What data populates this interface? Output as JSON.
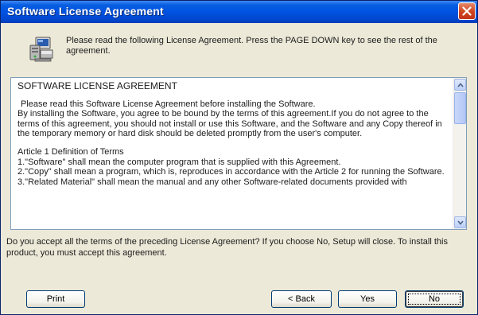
{
  "window": {
    "title": "Software License Agreement"
  },
  "header": {
    "instruction": "Please read the following License Agreement. Press the PAGE DOWN key to see the rest of the agreement.",
    "icon": "setup-computer-icon"
  },
  "license": {
    "heading": "SOFTWARE LICENSE AGREEMENT",
    "intro": "Please read this Software License Agreement before installing the Software.",
    "para1": "By installing the Software, you agree to be bound by the terms of this agreement.If you do not agree to the terms of this agreement, you should not install or use this Software, and the Software and any Copy thereof in the temporary memory or hard disk should be deleted promptly from the user's computer.",
    "article_title": "Article 1 Definition of Terms",
    "term1": "1.\"Software\" shall mean the computer program that is supplied with this Agreement.",
    "term2": "2.\"Copy\" shall mean a program, which is, reproduces in accordance with the Article 2 for running the Software.",
    "term3": "3.\"Related Material\"  shall mean the manual and any other Software-related documents provided with"
  },
  "question": "Do you accept all the terms of the preceding License Agreement? If you choose No, Setup will close. To install this product, you must accept this agreement.",
  "buttons": {
    "print": "Print",
    "back": "< Back",
    "yes": "Yes",
    "no": "No"
  },
  "colors": {
    "titlebar": "#0054e3",
    "face": "#ece9d8",
    "close": "#d0421c"
  }
}
